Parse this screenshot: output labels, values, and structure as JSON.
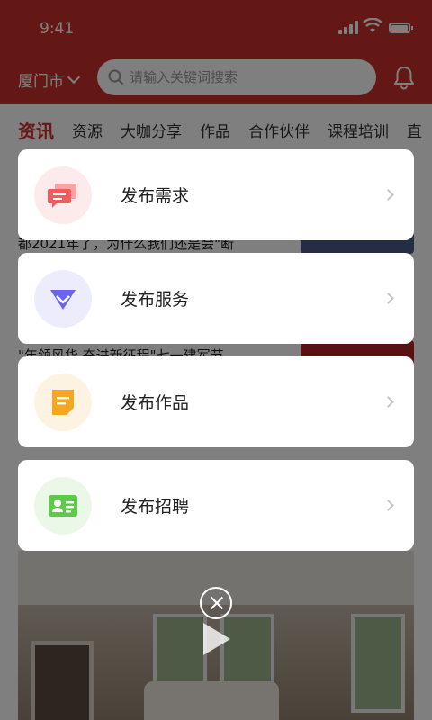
{
  "status_bar": {
    "time": "9:41"
  },
  "header": {
    "city": "厦门市",
    "search_placeholder": "请输入关键词搜索",
    "bell_icon": "bell-icon",
    "bg_color": "#c8302c"
  },
  "tabs": [
    "资讯",
    "资源",
    "大咖分享",
    "作品",
    "合作伙伴",
    "课程培训",
    "直"
  ],
  "background_headlines": [
    "都2021年了，为什么我们还是会\"断",
    "\"年领风华 奋进新征程\"七一建军节"
  ],
  "popup": {
    "items": [
      {
        "label": "发布需求",
        "icon": "message-icon",
        "color": "#f05b5b",
        "bg": "#fdeaea"
      },
      {
        "label": "发布服务",
        "icon": "diamond-icon",
        "color": "#6a64f0",
        "bg": "#ececfd"
      },
      {
        "label": "发布作品",
        "icon": "document-icon",
        "color": "#f5a623",
        "bg": "#fdf3e3"
      },
      {
        "label": "发布招聘",
        "icon": "id-card-icon",
        "color": "#5fc94a",
        "bg": "#ebf8e8"
      }
    ],
    "close_icon": "close-icon"
  }
}
